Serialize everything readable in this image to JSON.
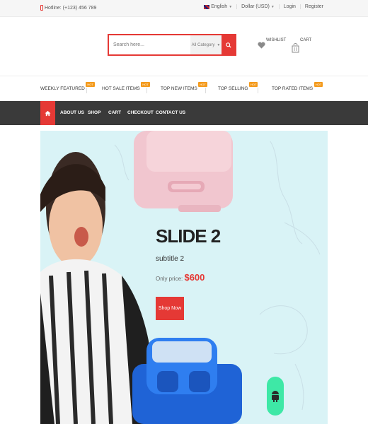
{
  "topbar": {
    "hotline": "Hotline: (+123) 456 789",
    "language": "English",
    "currency": "Dollar (USD)",
    "login": "Login",
    "register": "Register"
  },
  "header": {
    "search_placeholder": "Search here...",
    "category": "All Category",
    "wishlist_label": "WISHLIST",
    "cart_label": "CART"
  },
  "featured": {
    "badge": "HOT",
    "items": [
      {
        "label": "WEEKLY FEATURED"
      },
      {
        "label": "HOT SALE ITEMS"
      },
      {
        "label": "TOP NEW ITEMS"
      },
      {
        "label": "TOP SELLING"
      },
      {
        "label": "TOP RATED ITEMS"
      }
    ]
  },
  "nav": {
    "items": [
      "ABOUT US",
      "SHOP",
      "CART",
      "CHECKOUT",
      "CONTACT US"
    ]
  },
  "slide": {
    "title": "SLIDE 2",
    "subtitle": "subtitle 2",
    "price_prefix": "Only price:",
    "price": "$600",
    "button": "Shop Now"
  },
  "colors": {
    "accent": "#e53935",
    "nav_bg": "#3a3a3a",
    "hot_badge": "#f49a1b",
    "slider_bg": "#d9f3f6",
    "android_badge": "#3ee8a6"
  },
  "icons": [
    "phone-icon",
    "flag-icon",
    "search-icon",
    "heart-icon",
    "basket-icon",
    "home-icon",
    "android-icon"
  ]
}
